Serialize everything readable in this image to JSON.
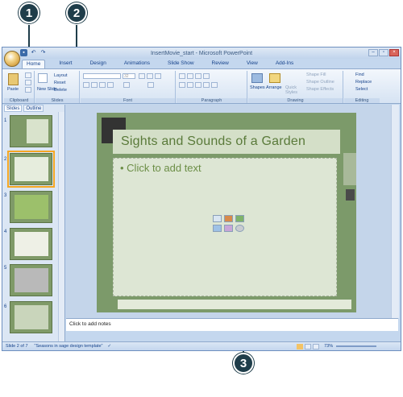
{
  "callouts": [
    "1",
    "2",
    "3"
  ],
  "window": {
    "title": "InsertMovie_start - Microsoft PowerPoint"
  },
  "tabs": [
    "Home",
    "Insert",
    "Design",
    "Animations",
    "Slide Show",
    "Review",
    "View",
    "Add-Ins"
  ],
  "ribbon": {
    "clipboard": {
      "paste": "Paste",
      "label": "Clipboard"
    },
    "slides": {
      "new_slide": "New Slide",
      "layout": "Layout",
      "reset": "Reset",
      "delete": "Delete",
      "label": "Slides"
    },
    "font": {
      "label": "Font",
      "size": "32"
    },
    "paragraph": {
      "label": "Paragraph"
    },
    "drawing": {
      "shapes": "Shapes",
      "arrange": "Arrange",
      "quick_styles": "Quick Styles",
      "shape_fill": "Shape Fill",
      "shape_outline": "Shape Outline",
      "shape_effects": "Shape Effects",
      "label": "Drawing"
    },
    "editing": {
      "find": "Find",
      "replace": "Replace",
      "select": "Select",
      "label": "Editing"
    }
  },
  "pane": {
    "tab_slides": "Slides",
    "tab_outline": "Outline",
    "slide_numbers": [
      "1",
      "2",
      "3",
      "4",
      "5",
      "6"
    ]
  },
  "slide": {
    "title": "Sights and Sounds of a Garden",
    "body_placeholder": "• Click to add text"
  },
  "notes_placeholder": "Click to add notes",
  "status": {
    "slide": "Slide 2 of 7",
    "theme": "\"Seasons in sage design template\"",
    "zoom": "73%"
  }
}
